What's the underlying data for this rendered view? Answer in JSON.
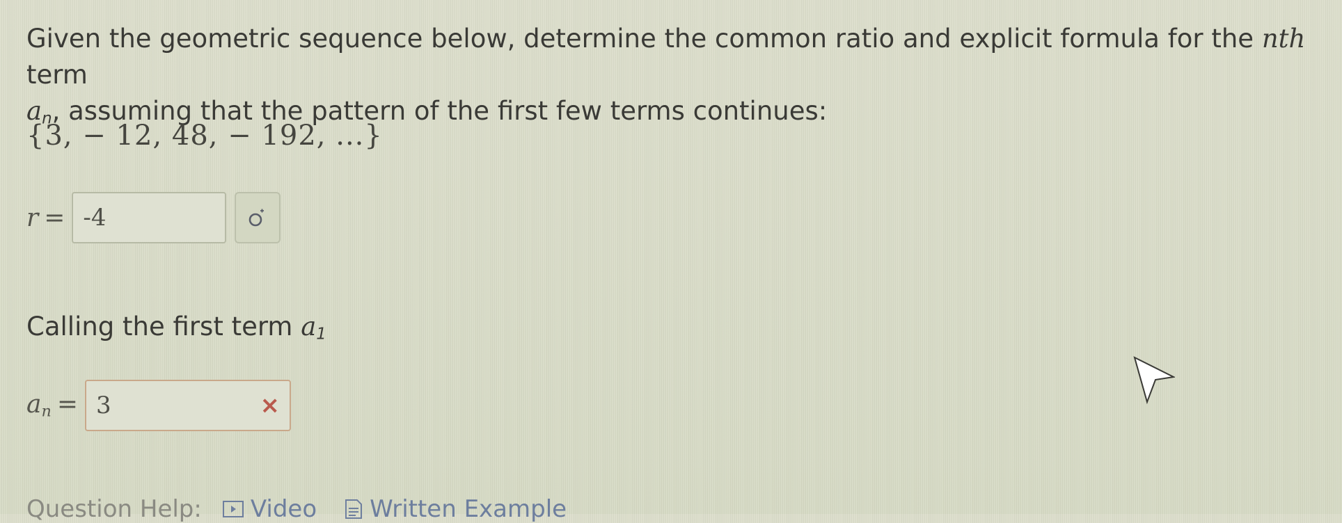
{
  "prompt": {
    "line1": "Given the geometric sequence below, determine the common ratio and explicit formula for the ",
    "nth": "nth",
    "line1_end": " term",
    "an_symbol": "a",
    "an_sub": "n",
    "line2": ", assuming that the pattern of the first few terms continues:"
  },
  "sequence": "{3,  − 12,  48,  − 192,  ...}",
  "ratio": {
    "label": "r",
    "equals": "=",
    "value": "-4"
  },
  "calling": {
    "text": "Calling the first term ",
    "symbol": "a",
    "sub": "1"
  },
  "formula": {
    "label": "a",
    "sub": "n",
    "equals": "=",
    "value": "3"
  },
  "help": {
    "label": "Question Help:",
    "video": "Video",
    "example": "Written Example"
  },
  "colors": {
    "background": "#d9dcc8",
    "error_mark": "#b95a4d",
    "link": "#6d7e9e"
  },
  "icons": {
    "math_palette": "sigma-icon",
    "clear": "close-icon",
    "video": "video-icon",
    "example": "document-icon",
    "pointer": "mouse-cursor-icon"
  }
}
